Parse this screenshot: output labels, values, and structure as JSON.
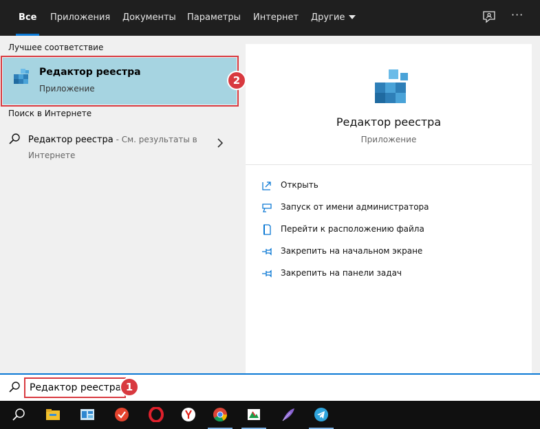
{
  "tabs": [
    {
      "label": "Все",
      "active": true
    },
    {
      "label": "Приложения"
    },
    {
      "label": "Документы"
    },
    {
      "label": "Параметры"
    },
    {
      "label": "Интернет"
    },
    {
      "label": "Другие"
    }
  ],
  "top_actions": {
    "more": "···"
  },
  "best_match": {
    "section_label": "Лучшее соответствие",
    "title": "Редактор реестра",
    "subtitle": "Приложение",
    "badge": "2"
  },
  "web": {
    "section_label": "Поиск в Интернете",
    "query": "Редактор реестра",
    "suffix": " - См. результаты в Интернете"
  },
  "detail": {
    "title": "Редактор реестра",
    "subtitle": "Приложение",
    "actions": [
      "Открыть",
      "Запуск от имени администратора",
      "Перейти к расположению файла",
      "Закрепить на начальном экране",
      "Закрепить на панели задач"
    ]
  },
  "search": {
    "value": "Редактор реестра",
    "badge": "1"
  },
  "taskbar_icons": [
    "search-icon",
    "file-explorer-icon",
    "control-panel-icon",
    "todoist-icon",
    "opera-icon",
    "yandex-browser-icon",
    "chrome-icon",
    "mail-app-icon",
    "feather-app-icon",
    "telegram-icon"
  ],
  "colors": {
    "accent": "#0a78d4",
    "highlight": "#a6d4e1",
    "annotation": "#d8393f"
  }
}
